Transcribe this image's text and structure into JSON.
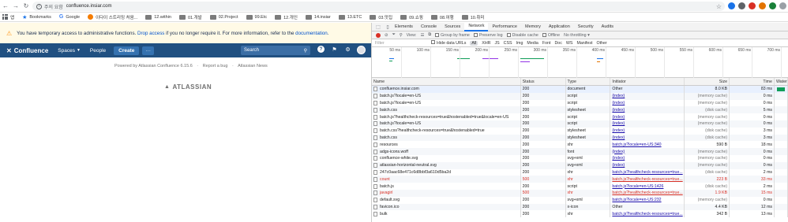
{
  "browser": {
    "insecure_label": "주의 요함",
    "url": "confluence.insiar.com",
    "bookmarks": [
      {
        "label": "앱",
        "icon": "apps-icon"
      },
      {
        "label": "Bookmarks",
        "icon": "star-icon"
      },
      {
        "label": "Google",
        "icon": "google-icon"
      },
      {
        "label": "이다이 스트리밍 처음...",
        "icon": "fire-icon"
      },
      {
        "label": "12.within",
        "icon": "folder-icon"
      },
      {
        "label": "01.개발",
        "icon": "folder-icon"
      },
      {
        "label": "02.Project",
        "icon": "folder-icon"
      },
      {
        "label": "99.Etc",
        "icon": "folder-icon"
      },
      {
        "label": "12.개인",
        "icon": "folder-icon"
      },
      {
        "label": "14.insiar",
        "icon": "folder-icon"
      },
      {
        "label": "13.ETC",
        "icon": "folder-icon"
      },
      {
        "label": "03.맛집",
        "icon": "folder-icon"
      },
      {
        "label": "09.쇼핑",
        "icon": "folder-icon"
      },
      {
        "label": "08.여행",
        "icon": "folder-icon"
      },
      {
        "label": "10.취미",
        "icon": "folder-icon"
      }
    ]
  },
  "banner": {
    "text_before": "You have temporary access to administrative functions. ",
    "drop_link": "Drop access",
    "text_middle": " if you no longer require it. For more information, refer to the ",
    "doc_link": "documentation",
    "text_after": "."
  },
  "confluence_nav": {
    "logo": "Confluence",
    "spaces": "Spaces",
    "people": "People",
    "create": "Create",
    "more": "···",
    "search_placeholder": "Search",
    "brand_color": "#205081"
  },
  "footer": {
    "powered": "Powered by Atlassian Confluence 6.15.6",
    "report": "Report a bug",
    "news": "Atlassian News",
    "logo": "ATLASSIAN"
  },
  "devtools": {
    "tabs": [
      "Elements",
      "Console",
      "Sources",
      "Network",
      "Performance",
      "Memory",
      "Application",
      "Security",
      "Audits"
    ],
    "active_tab": "Network",
    "toolbar": {
      "view": "View:",
      "group_by_frame": "Group by frame",
      "preserve_log": "Preserve log",
      "disable_cache": "Disable cache",
      "offline": "Offline",
      "throttling": "No throttling"
    },
    "filter": {
      "placeholder": "Filter",
      "hide_data_urls": "Hide data URLs",
      "types": [
        "All",
        "XHR",
        "JS",
        "CSS",
        "Img",
        "Media",
        "Font",
        "Doc",
        "WS",
        "Manifest",
        "Other"
      ]
    },
    "timeline_ticks": [
      "50 ms",
      "100 ms",
      "150 ms",
      "200 ms",
      "250 ms",
      "300 ms",
      "350 ms",
      "400 ms",
      "450 ms",
      "500 ms",
      "550 ms",
      "600 ms",
      "650 ms",
      "700 ms"
    ],
    "columns": [
      "Name",
      "Status",
      "Type",
      "Initiator",
      "Size",
      "Time",
      "Waterfall"
    ],
    "rows": [
      {
        "name": "confluence.insiar.com",
        "status": "200",
        "type": "document",
        "initiator": "Other",
        "size": "8.0 KB",
        "time": "83 ms",
        "init_link": false,
        "size_muted": false,
        "err": false,
        "wf": 0.7
      },
      {
        "name": "batch.js?locale=en-US",
        "status": "200",
        "type": "script",
        "initiator": "(index)",
        "size": "(memory cache)",
        "time": "0 ms",
        "init_link": true,
        "size_muted": true,
        "err": false,
        "wf": 0
      },
      {
        "name": "batch.js?locale=en-US",
        "status": "200",
        "type": "script",
        "initiator": "(index)",
        "size": "(memory cache)",
        "time": "0 ms",
        "init_link": true,
        "size_muted": true,
        "err": false,
        "wf": 0
      },
      {
        "name": "batch.css",
        "status": "200",
        "type": "stylesheet",
        "initiator": "(index)",
        "size": "(disk cache)",
        "time": "5 ms",
        "init_link": true,
        "size_muted": true,
        "err": false,
        "wf": 0
      },
      {
        "name": "batch.js?healthcheck-resources=true&hostenabled=true&locale=en-US",
        "status": "200",
        "type": "script",
        "initiator": "(index)",
        "size": "(memory cache)",
        "time": "0 ms",
        "init_link": true,
        "size_muted": true,
        "err": false,
        "wf": 0
      },
      {
        "name": "batch.js?locale=en-US",
        "status": "200",
        "type": "script",
        "initiator": "(index)",
        "size": "(memory cache)",
        "time": "0 ms",
        "init_link": true,
        "size_muted": true,
        "err": false,
        "wf": 0
      },
      {
        "name": "batch.css?healthcheck-resources=true&hostenabled=true",
        "status": "200",
        "type": "stylesheet",
        "initiator": "(index)",
        "size": "(disk cache)",
        "time": "3 ms",
        "init_link": true,
        "size_muted": true,
        "err": false,
        "wf": 0
      },
      {
        "name": "batch.css",
        "status": "200",
        "type": "stylesheet",
        "initiator": "(index)",
        "size": "(disk cache)",
        "time": "3 ms",
        "init_link": true,
        "size_muted": true,
        "err": false,
        "wf": 0
      },
      {
        "name": "resources",
        "status": "200",
        "type": "xhr",
        "initiator": "batch.js?locale=en-US:340",
        "size": "590 B",
        "time": "18 ms",
        "init_link": true,
        "size_muted": false,
        "err": false,
        "wf": 0
      },
      {
        "name": "adgs-icons.woff",
        "status": "200",
        "type": "font",
        "initiator": "(index)",
        "size": "(memory cache)",
        "time": "0 ms",
        "init_link": true,
        "size_muted": true,
        "err": false,
        "wf": 0
      },
      {
        "name": "confluence-white.svg",
        "status": "200",
        "type": "svg+xml",
        "initiator": "(index)",
        "size": "(memory cache)",
        "time": "0 ms",
        "init_link": true,
        "size_muted": true,
        "err": false,
        "wf": 0
      },
      {
        "name": "atlassian-horizontal-neutral.svg",
        "status": "200",
        "type": "svg+xml",
        "initiator": "(index)",
        "size": "(memory cache)",
        "time": "0 ms",
        "init_link": true,
        "size_muted": true,
        "err": false,
        "wf": 0
      },
      {
        "name": "247c0aac68e471c6d8bbf3a610d5ba2d",
        "status": "200",
        "type": "xhr",
        "initiator": "batch.js?healthcheck-resources=true...",
        "size": "(disk cache)",
        "time": "2 ms",
        "init_link": true,
        "size_muted": true,
        "err": false,
        "wf": 0
      },
      {
        "name": "count",
        "status": "500",
        "type": "xhr",
        "initiator": "batch.js?healthcheck-resources=true...",
        "size": "223 B",
        "time": "33 ms",
        "init_link": true,
        "size_muted": false,
        "err": true,
        "wf": 0
      },
      {
        "name": "batch.js",
        "status": "200",
        "type": "script",
        "initiator": "batch.js?locale=en-US:1426",
        "size": "(disk cache)",
        "time": "2 ms",
        "init_link": true,
        "size_muted": true,
        "err": false,
        "wf": 0
      },
      {
        "name": "javagirl",
        "status": "500",
        "type": "xhr",
        "initiator": "batch.js?healthcheck-resources=true...",
        "size": "1.9 KB",
        "time": "15 ms",
        "init_link": true,
        "size_muted": false,
        "err": true,
        "wf": 0
      },
      {
        "name": "default.svg",
        "status": "200",
        "type": "svg+xml",
        "initiator": "batch.js?locale=en-US:232",
        "size": "(memory cache)",
        "time": "0 ms",
        "init_link": true,
        "size_muted": true,
        "err": false,
        "wf": 0
      },
      {
        "name": "favicon.ico",
        "status": "200",
        "type": "x-icon",
        "initiator": "Other",
        "size": "4.4 KB",
        "time": "12 ms",
        "init_link": false,
        "size_muted": false,
        "err": false,
        "wf": 0
      },
      {
        "name": "bulk",
        "status": "200",
        "type": "xhr",
        "initiator": "batch.js?healthcheck-resources=true...",
        "size": "342 B",
        "time": "13 ms",
        "init_link": true,
        "size_muted": false,
        "err": false,
        "wf": 0
      }
    ]
  }
}
